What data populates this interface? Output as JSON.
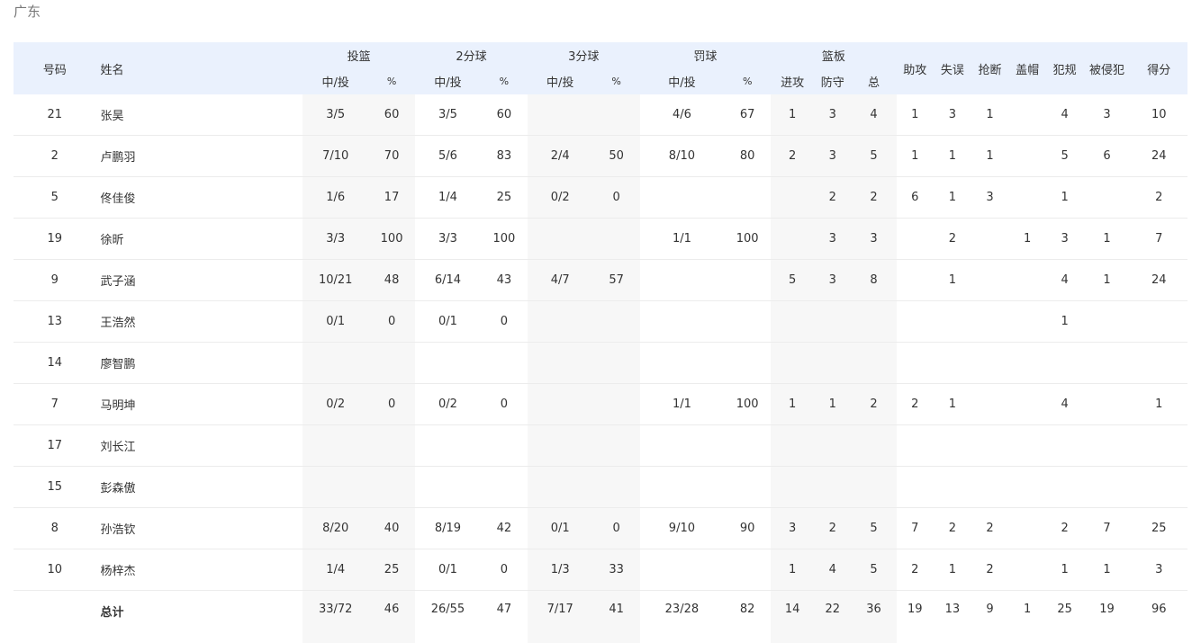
{
  "team": "广东",
  "headers": {
    "number": "号码",
    "name": "姓名",
    "fg": "投篮",
    "two": "2分球",
    "three": "3分球",
    "ft": "罚球",
    "reb": "篮板",
    "made_att": "中/投",
    "pct": "%",
    "off": "进攻",
    "def": "防守",
    "tot": "总",
    "ast": "助攻",
    "tov": "失误",
    "stl": "抢断",
    "blk": "盖帽",
    "pf": "犯规",
    "fd": "被侵犯",
    "pts": "得分"
  },
  "rows": [
    [
      "21",
      "张昊",
      "3/5",
      "60",
      "3/5",
      "60",
      "",
      "",
      "4/6",
      "67",
      "1",
      "3",
      "4",
      "1",
      "3",
      "1",
      "",
      "4",
      "3",
      "10"
    ],
    [
      "2",
      "卢鹏羽",
      "7/10",
      "70",
      "5/6",
      "83",
      "2/4",
      "50",
      "8/10",
      "80",
      "2",
      "3",
      "5",
      "1",
      "1",
      "1",
      "",
      "5",
      "6",
      "24"
    ],
    [
      "5",
      "佟佳俊",
      "1/6",
      "17",
      "1/4",
      "25",
      "0/2",
      "0",
      "",
      "",
      "",
      "2",
      "2",
      "6",
      "1",
      "3",
      "",
      "1",
      "",
      "2"
    ],
    [
      "19",
      "徐昕",
      "3/3",
      "100",
      "3/3",
      "100",
      "",
      "",
      "1/1",
      "100",
      "",
      "3",
      "3",
      "",
      "2",
      "",
      "1",
      "3",
      "1",
      "7"
    ],
    [
      "9",
      "武子涵",
      "10/21",
      "48",
      "6/14",
      "43",
      "4/7",
      "57",
      "",
      "",
      "5",
      "3",
      "8",
      "",
      "1",
      "",
      "",
      "4",
      "1",
      "24"
    ],
    [
      "13",
      "王浩然",
      "0/1",
      "0",
      "0/1",
      "0",
      "",
      "",
      "",
      "",
      "",
      "",
      "",
      "",
      "",
      "",
      "",
      "1",
      "",
      ""
    ],
    [
      "14",
      "廖智鹏",
      "",
      "",
      "",
      "",
      "",
      "",
      "",
      "",
      "",
      "",
      "",
      "",
      "",
      "",
      "",
      "",
      "",
      ""
    ],
    [
      "7",
      "马明坤",
      "0/2",
      "0",
      "0/2",
      "0",
      "",
      "",
      "1/1",
      "100",
      "1",
      "1",
      "2",
      "2",
      "1",
      "",
      "",
      "4",
      "",
      "1"
    ],
    [
      "17",
      "刘长江",
      "",
      "",
      "",
      "",
      "",
      "",
      "",
      "",
      "",
      "",
      "",
      "",
      "",
      "",
      "",
      "",
      "",
      ""
    ],
    [
      "15",
      "彭森傲",
      "",
      "",
      "",
      "",
      "",
      "",
      "",
      "",
      "",
      "",
      "",
      "",
      "",
      "",
      "",
      "",
      "",
      ""
    ],
    [
      "8",
      "孙浩钦",
      "8/20",
      "40",
      "8/19",
      "42",
      "0/1",
      "0",
      "9/10",
      "90",
      "3",
      "2",
      "5",
      "7",
      "2",
      "2",
      "",
      "2",
      "7",
      "25"
    ],
    [
      "10",
      "杨梓杰",
      "1/4",
      "25",
      "0/1",
      "0",
      "1/3",
      "33",
      "",
      "",
      "1",
      "4",
      "5",
      "2",
      "1",
      "2",
      "",
      "1",
      "1",
      "3"
    ]
  ],
  "total": [
    "",
    "总计",
    "33/72",
    "46",
    "26/55",
    "47",
    "7/17",
    "41",
    "23/28",
    "82",
    "14",
    "22",
    "36",
    "19",
    "13",
    "9",
    "1",
    "25",
    "19",
    "96"
  ]
}
